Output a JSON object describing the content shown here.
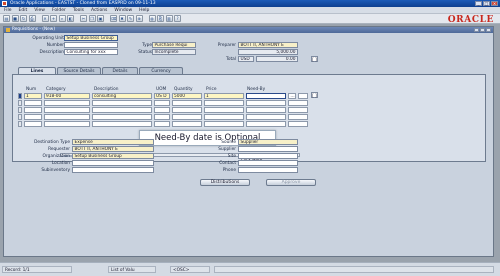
{
  "app": {
    "title": "Oracle Applications - EASTST - Cloned from EASPRD on 09-11-13",
    "logo_text": "ORACLE",
    "menu": [
      "File",
      "Edit",
      "View",
      "Folder",
      "Tools",
      "Actions",
      "Window",
      "Help"
    ]
  },
  "form": {
    "title": "Requisitions - (New)",
    "header": {
      "operating_unit_label": "Operating Unit",
      "operating_unit_value": "Setup Business Group",
      "number_label": "Number",
      "number_value": "",
      "description_label": "Description",
      "description_value": "Consulting for xxx",
      "type_label": "Type",
      "type_value": "Purchase Requi",
      "status_label": "Status",
      "status_value": "Incomplete",
      "preparer_label": "Preparer",
      "preparer_value": "BOTT II, ANTHONY E",
      "total_label": "Total",
      "total_currency": "USD",
      "total_value": "5,000.00",
      "preparer_amount": "0.00",
      "side_btn": "[ ]",
      "side_btn2": "[ ]"
    },
    "tabs": [
      {
        "label": "Lines",
        "active": true
      },
      {
        "label": "Source Details",
        "active": false
      },
      {
        "label": "Details",
        "active": false
      },
      {
        "label": "Currency",
        "active": false
      }
    ],
    "columns": {
      "num": "Num",
      "category": "Category",
      "description": "Description",
      "uom": "UOM",
      "quantity": "Quantity",
      "price": "Price",
      "need_by": "Need-By"
    },
    "lines": [
      {
        "num": "1",
        "category": "918-00",
        "description": "consulting",
        "uom": "US D",
        "quantity": "5000",
        "price": "1",
        "need_by": ""
      }
    ],
    "tooltip": "Need-By date is Optional",
    "click_here": "Click Here",
    "details": {
      "destination_type_label": "Destination Type",
      "destination_type_value": "Expense",
      "requester_label": "Requester",
      "requester_value": "BOTT II, ANTHONY E",
      "organization_label": "Organization",
      "organization_value": "Setup Business Group",
      "location_label": "Location",
      "location_value": "",
      "subinventory_label": "Subinventory",
      "subinventory_value": "",
      "source_label": "Source",
      "source_value": "Supplier",
      "supplier_label": "Supplier",
      "supplier_value": "",
      "site_label": "Site",
      "site_value": "",
      "contact_label": "Contact",
      "contact_value": "",
      "phone_label": "Phone",
      "phone_value": ""
    },
    "buttons": {
      "distributions": "Distributions",
      "approve": "Approve"
    }
  },
  "statusbar": {
    "record": "Record: 1/1",
    "list_of_values": "List of Valu",
    "osc": "<OSC>"
  },
  "colors": {
    "titlebar": "#1c5bb8",
    "form_bg": "#c9d2de",
    "required_field": "#f7f0c8",
    "oracle_red": "#c8281e"
  }
}
